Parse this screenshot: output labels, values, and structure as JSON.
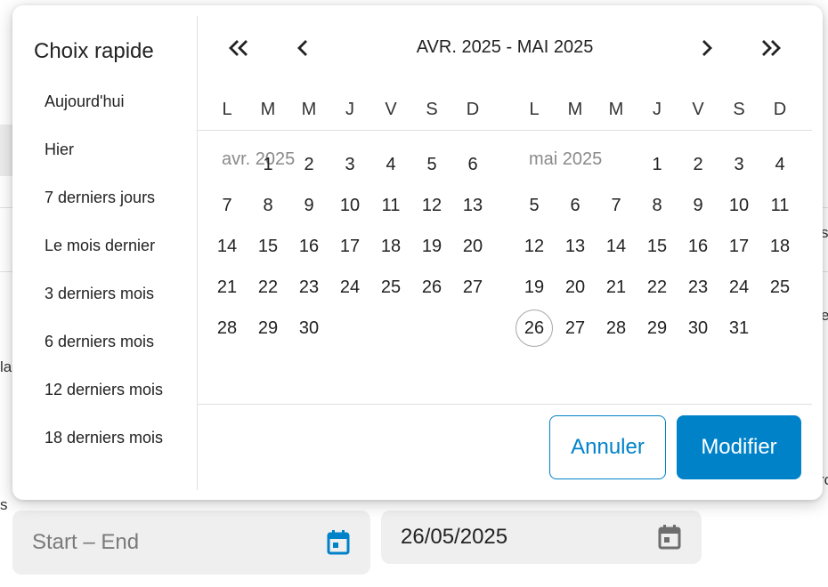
{
  "background": {
    "fragments": [
      "s",
      "e",
      "la",
      "s",
      "ro"
    ]
  },
  "fields": {
    "range_placeholder": "Start – End",
    "date_value": "26/05/2025"
  },
  "quick_select": {
    "title": "Choix rapide",
    "items": [
      "Aujourd'hui",
      "Hier",
      "7 derniers jours",
      "Le mois dernier",
      "3 derniers mois",
      "6 derniers mois",
      "12 derniers mois",
      "18 derniers mois"
    ]
  },
  "calendar": {
    "range_title": "AVR. 2025 - MAI 2025",
    "weekdays": [
      "L",
      "M",
      "M",
      "J",
      "V",
      "S",
      "D"
    ],
    "months": [
      {
        "label": "avr. 2025",
        "first_weekday_index": 1,
        "days": 30,
        "today": null
      },
      {
        "label": "mai 2025",
        "first_weekday_index": 3,
        "days": 31,
        "today": 26
      }
    ]
  },
  "actions": {
    "cancel": "Annuler",
    "modify": "Modifier"
  },
  "colors": {
    "accent": "#0082c9"
  }
}
